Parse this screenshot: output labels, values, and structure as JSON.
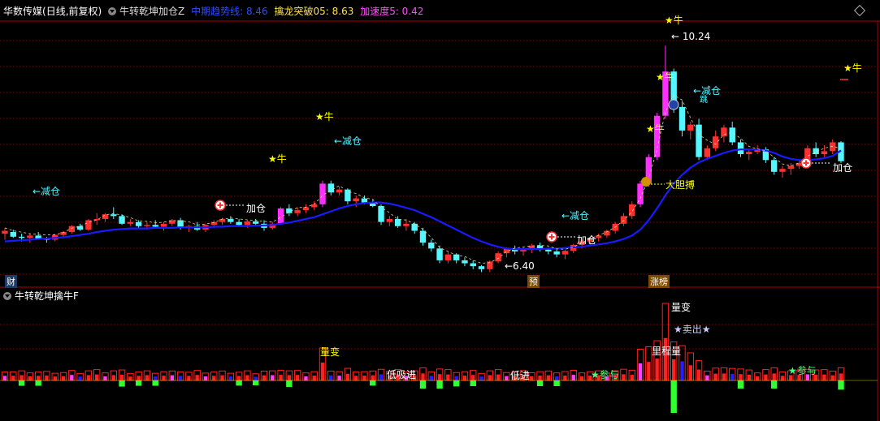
{
  "header": {
    "stock_name": "华数传媒",
    "period": "(日线,前复权)",
    "indicator": "牛转乾坤加仓Z",
    "ma_label": "中期趋势线: 8.46",
    "breakout_label": "擒龙突破05: 8.63",
    "accel_label": "加速度5: 0.42"
  },
  "sub_header": {
    "indicator": "牛转乾坤擒牛F"
  },
  "colors": {
    "up": "#ff3030",
    "down": "#54f7ff",
    "ma": "#1a1aff",
    "star": "#ffff00",
    "grid": "#8a0000",
    "magenta": "#ff30ff",
    "ma_label": "#2040ff",
    "breakout": "#ffff40",
    "accel": "#ff40ff"
  },
  "markers": {
    "cai": "财",
    "yu": "预",
    "zhangbang": "涨榜"
  },
  "annotations": {
    "jiancang": "←减仓",
    "jiacang": "加仓",
    "niu": "★牛",
    "high_price": "10.24",
    "low_price": "←6.40",
    "dadanbo": "大胆搏",
    "tiao": "跳"
  },
  "sub_annotations": {
    "liangbian": "量变",
    "zhongliang": "里程量",
    "maichu": "★卖出★",
    "dixijin": "低吸进",
    "dijin": "低进",
    "canyu": "★参与"
  },
  "chart_data": {
    "type": "candlestick",
    "ohlc": [
      [
        7.05,
        7.15,
        6.95,
        7.1
      ],
      [
        7.08,
        7.12,
        6.98,
        7.0
      ],
      [
        7.0,
        7.05,
        6.92,
        6.98
      ],
      [
        6.98,
        7.05,
        6.9,
        7.02
      ],
      [
        7.02,
        7.08,
        6.95,
        6.97
      ],
      [
        6.97,
        7.0,
        6.9,
        6.95
      ],
      [
        6.95,
        7.05,
        6.92,
        7.03
      ],
      [
        7.03,
        7.1,
        7.0,
        7.08
      ],
      [
        7.08,
        7.2,
        7.05,
        7.18
      ],
      [
        7.18,
        7.22,
        7.1,
        7.12
      ],
      [
        7.12,
        7.3,
        7.1,
        7.28
      ],
      [
        7.28,
        7.4,
        7.2,
        7.3
      ],
      [
        7.3,
        7.4,
        7.25,
        7.38
      ],
      [
        7.38,
        7.5,
        7.3,
        7.35
      ],
      [
        7.35,
        7.38,
        7.2,
        7.22
      ],
      [
        7.22,
        7.3,
        7.18,
        7.25
      ],
      [
        7.25,
        7.28,
        7.15,
        7.18
      ],
      [
        7.18,
        7.25,
        7.12,
        7.2
      ],
      [
        7.2,
        7.28,
        7.15,
        7.17
      ],
      [
        7.17,
        7.25,
        7.1,
        7.22
      ],
      [
        7.22,
        7.3,
        7.18,
        7.28
      ],
      [
        7.28,
        7.32,
        7.12,
        7.15
      ],
      [
        7.15,
        7.2,
        7.08,
        7.18
      ],
      [
        7.18,
        7.25,
        7.1,
        7.12
      ],
      [
        7.12,
        7.22,
        7.08,
        7.2
      ],
      [
        7.2,
        7.28,
        7.15,
        7.25
      ],
      [
        7.25,
        7.32,
        7.2,
        7.3
      ],
      [
        7.3,
        7.35,
        7.22,
        7.25
      ],
      [
        7.25,
        7.3,
        7.18,
        7.2
      ],
      [
        7.2,
        7.28,
        7.15,
        7.26
      ],
      [
        7.26,
        7.3,
        7.2,
        7.22
      ],
      [
        7.22,
        7.28,
        7.1,
        7.15
      ],
      [
        7.15,
        7.25,
        7.12,
        7.22
      ],
      [
        7.22,
        7.5,
        7.2,
        7.48
      ],
      [
        7.48,
        7.55,
        7.35,
        7.4
      ],
      [
        7.4,
        7.5,
        7.35,
        7.45
      ],
      [
        7.45,
        7.55,
        7.4,
        7.5
      ],
      [
        7.5,
        7.6,
        7.45,
        7.55
      ],
      [
        7.55,
        7.95,
        7.5,
        7.9
      ],
      [
        7.9,
        7.95,
        7.7,
        7.75
      ],
      [
        7.75,
        7.85,
        7.7,
        7.8
      ],
      [
        7.8,
        7.82,
        7.55,
        7.6
      ],
      [
        7.6,
        7.7,
        7.5,
        7.65
      ],
      [
        7.65,
        7.7,
        7.55,
        7.58
      ],
      [
        7.58,
        7.62,
        7.5,
        7.52
      ],
      [
        7.52,
        7.55,
        7.2,
        7.25
      ],
      [
        7.25,
        7.35,
        7.18,
        7.3
      ],
      [
        7.3,
        7.35,
        7.15,
        7.18
      ],
      [
        7.18,
        7.3,
        7.1,
        7.22
      ],
      [
        7.22,
        7.25,
        7.05,
        7.1
      ],
      [
        7.1,
        7.15,
        6.85,
        6.9
      ],
      [
        6.9,
        6.95,
        6.75,
        6.8
      ],
      [
        6.8,
        6.85,
        6.55,
        6.6
      ],
      [
        6.6,
        6.75,
        6.55,
        6.7
      ],
      [
        6.7,
        6.72,
        6.55,
        6.6
      ],
      [
        6.6,
        6.65,
        6.5,
        6.55
      ],
      [
        6.55,
        6.6,
        6.45,
        6.5
      ],
      [
        6.5,
        6.52,
        6.4,
        6.45
      ],
      [
        6.45,
        6.6,
        6.4,
        6.58
      ],
      [
        6.58,
        6.75,
        6.55,
        6.72
      ],
      [
        6.72,
        6.82,
        6.65,
        6.8
      ],
      [
        6.8,
        6.85,
        6.7,
        6.75
      ],
      [
        6.75,
        6.82,
        6.68,
        6.78
      ],
      [
        6.78,
        6.88,
        6.72,
        6.85
      ],
      [
        6.85,
        6.9,
        6.75,
        6.78
      ],
      [
        6.78,
        6.82,
        6.7,
        6.75
      ],
      [
        6.75,
        6.8,
        6.65,
        6.7
      ],
      [
        6.7,
        6.78,
        6.62,
        6.76
      ],
      [
        6.76,
        6.88,
        6.72,
        6.86
      ],
      [
        6.86,
        6.95,
        6.8,
        6.92
      ],
      [
        6.92,
        7.0,
        6.85,
        6.98
      ],
      [
        6.98,
        7.05,
        6.92,
        7.02
      ],
      [
        7.02,
        7.12,
        6.98,
        7.1
      ],
      [
        7.1,
        7.25,
        7.05,
        7.22
      ],
      [
        7.22,
        7.4,
        7.18,
        7.35
      ],
      [
        7.35,
        7.6,
        7.3,
        7.55
      ],
      [
        7.55,
        7.95,
        7.5,
        7.9
      ],
      [
        7.9,
        8.4,
        7.85,
        8.35
      ],
      [
        8.35,
        9.1,
        8.3,
        9.05
      ],
      [
        9.05,
        10.24,
        9.0,
        9.8
      ],
      [
        9.8,
        9.85,
        9.1,
        9.2
      ],
      [
        9.2,
        9.3,
        8.7,
        8.8
      ],
      [
        8.8,
        8.95,
        8.65,
        8.9
      ],
      [
        8.9,
        9.0,
        8.3,
        8.35
      ],
      [
        8.35,
        8.55,
        8.3,
        8.5
      ],
      [
        8.5,
        8.8,
        8.45,
        8.7
      ],
      [
        8.7,
        8.9,
        8.6,
        8.85
      ],
      [
        8.85,
        8.95,
        8.55,
        8.6
      ],
      [
        8.6,
        8.65,
        8.35,
        8.4
      ],
      [
        8.4,
        8.48,
        8.3,
        8.44
      ],
      [
        8.44,
        8.55,
        8.4,
        8.48
      ],
      [
        8.48,
        8.52,
        8.25,
        8.3
      ],
      [
        8.3,
        8.35,
        8.05,
        8.1
      ],
      [
        8.1,
        8.2,
        8.0,
        8.15
      ],
      [
        8.15,
        8.25,
        8.05,
        8.2
      ],
      [
        8.2,
        8.3,
        8.15,
        8.25
      ],
      [
        8.25,
        8.55,
        8.2,
        8.5
      ],
      [
        8.5,
        8.6,
        8.35,
        8.4
      ],
      [
        8.4,
        8.55,
        8.35,
        8.45
      ],
      [
        8.45,
        8.65,
        8.4,
        8.6
      ],
      [
        8.6,
        8.62,
        8.25,
        8.28
      ]
    ],
    "ma": [
      6.92,
      6.93,
      6.94,
      6.95,
      6.96,
      6.97,
      6.98,
      6.99,
      7.01,
      7.03,
      7.05,
      7.08,
      7.1,
      7.12,
      7.13,
      7.14,
      7.14,
      7.14,
      7.15,
      7.15,
      7.15,
      7.16,
      7.16,
      7.16,
      7.16,
      7.17,
      7.17,
      7.18,
      7.18,
      7.18,
      7.19,
      7.19,
      7.2,
      7.22,
      7.24,
      7.27,
      7.3,
      7.33,
      7.38,
      7.43,
      7.48,
      7.52,
      7.55,
      7.57,
      7.58,
      7.58,
      7.56,
      7.53,
      7.49,
      7.45,
      7.39,
      7.33,
      7.26,
      7.19,
      7.12,
      7.05,
      6.98,
      6.92,
      6.87,
      6.83,
      6.8,
      6.79,
      6.79,
      6.79,
      6.79,
      6.8,
      6.8,
      6.81,
      6.82,
      6.83,
      6.85,
      6.87,
      6.89,
      6.92,
      6.96,
      7.02,
      7.12,
      7.28,
      7.48,
      7.7,
      7.9,
      8.05,
      8.17,
      8.26,
      8.32,
      8.37,
      8.42,
      8.46,
      8.48,
      8.48,
      8.48,
      8.46,
      8.42,
      8.36,
      8.32,
      8.3,
      8.3,
      8.31,
      8.33,
      8.37,
      8.46
    ],
    "ylim": [
      6.2,
      10.6
    ]
  }
}
